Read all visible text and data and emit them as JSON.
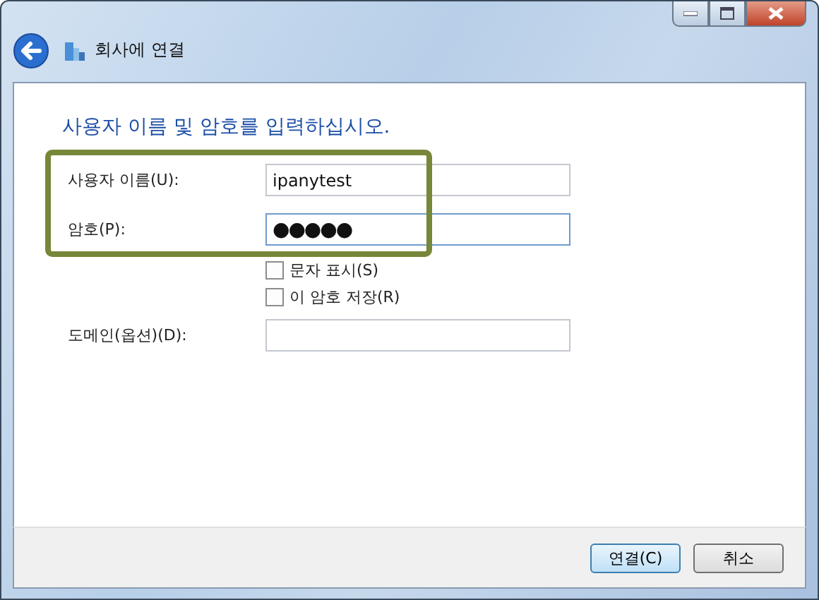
{
  "window": {
    "title": "회사에 연결"
  },
  "heading": "사용자 이름 및 암호를 입력하십시오.",
  "fields": [
    {
      "label": "사용자 이름(U):",
      "value": "ipanytest",
      "focused": false
    },
    {
      "label": "암호(P):",
      "value": "●●●●●",
      "focused": true
    }
  ],
  "checkboxes": [
    {
      "label": "문자 표시(S)",
      "checked": false
    },
    {
      "label": "이 암호 저장(R)",
      "checked": false
    }
  ],
  "domain": {
    "label": "도메인(옵션)(D):",
    "focused": false
  },
  "buttons": [
    {
      "label": "연결(C)",
      "default": true
    },
    {
      "label": "취소",
      "default": false
    }
  ]
}
